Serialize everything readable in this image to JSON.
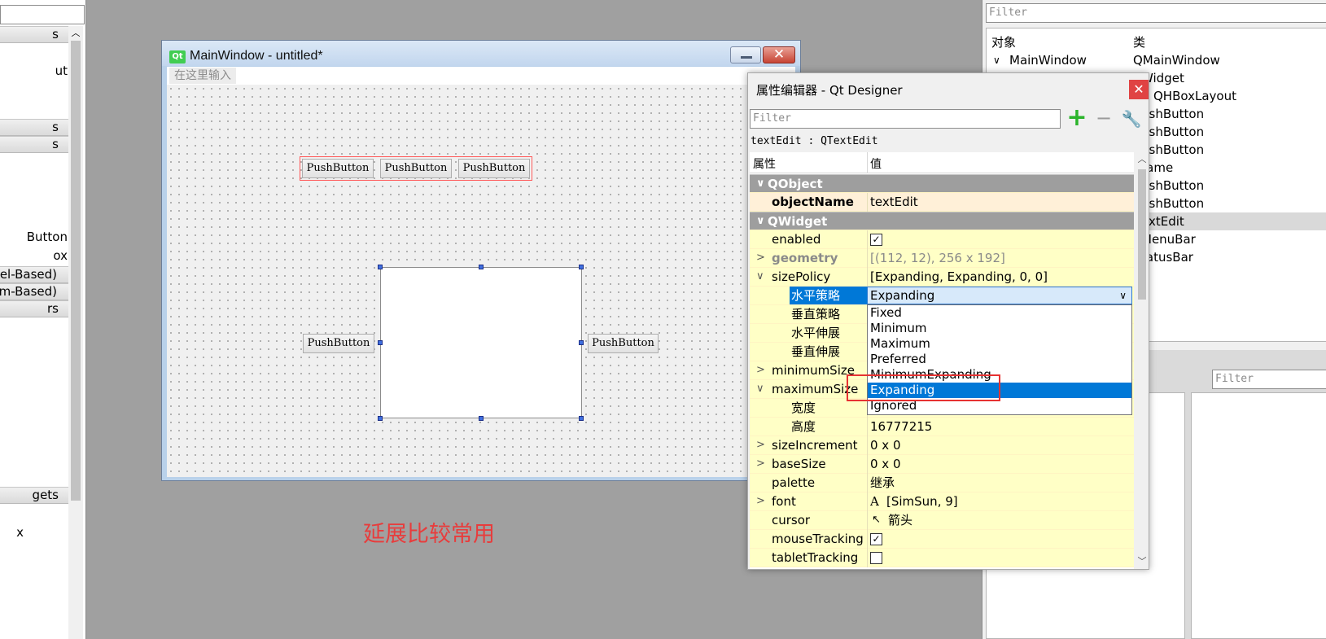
{
  "widget_box": {
    "categories": [
      "s",
      "s",
      "s",
      "del-Based)",
      "em-Based)",
      "rs",
      "gets"
    ],
    "items": [
      "ut",
      "Button",
      "ox",
      "x"
    ]
  },
  "main_window": {
    "title": "MainWindow - untitled*",
    "logo_text": "Qt",
    "menu_placeholder": "在这里输入",
    "close_glyph": "✕",
    "top_buttons": [
      "PushButton",
      "PushButton",
      "PushButton"
    ],
    "left_button": "PushButton",
    "right_button": "PushButton"
  },
  "annotation": "延展比较常用",
  "object_inspector": {
    "filter_placeholder": "Filter",
    "col_object": "对象",
    "col_class": "类",
    "rows": [
      {
        "name": "MainWindow",
        "class": "QMainWindow"
      },
      {
        "name": "",
        "class": "Widget"
      },
      {
        "name": "",
        "class": "QHBoxLayout"
      },
      {
        "name": "",
        "class": "ushButton"
      },
      {
        "name": "",
        "class": "ushButton"
      },
      {
        "name": "",
        "class": "ushButton"
      },
      {
        "name": "",
        "class": "rame"
      },
      {
        "name": "",
        "class": "ushButton"
      },
      {
        "name": "",
        "class": "ushButton"
      },
      {
        "name": "",
        "class": "extEdit"
      },
      {
        "name": "",
        "class": "MenuBar"
      },
      {
        "name": "",
        "class": "tatusBar"
      }
    ],
    "signal_filter_placeholder": "Filter"
  },
  "property_editor": {
    "title": "属性编辑器 - Qt Designer",
    "close_glyph": "✕",
    "filter_placeholder": "Filter",
    "object_info": "textEdit : QTextEdit",
    "col_property": "属性",
    "col_value": "值",
    "rows": [
      {
        "kind": "category",
        "name": "QObject"
      },
      {
        "kind": "prop",
        "name": "objectName",
        "value": "textEdit"
      },
      {
        "kind": "category",
        "name": "QWidget"
      },
      {
        "kind": "prop",
        "name": "enabled",
        "checked": true
      },
      {
        "kind": "prop",
        "name": "geometry",
        "value": "[(112, 12), 256 x 192]"
      },
      {
        "kind": "prop",
        "name": "sizePolicy",
        "value": "[Expanding, Expanding, 0, 0]"
      },
      {
        "kind": "sub",
        "name": "水平策略",
        "value": "Expanding"
      },
      {
        "kind": "sub",
        "name": "垂直策略",
        "value": ""
      },
      {
        "kind": "sub",
        "name": "水平伸展",
        "value": ""
      },
      {
        "kind": "sub",
        "name": "垂直伸展",
        "value": ""
      },
      {
        "kind": "prop",
        "name": "minimumSize",
        "value": ""
      },
      {
        "kind": "prop",
        "name": "maximumSize",
        "value": ""
      },
      {
        "kind": "sub",
        "name": "宽度",
        "value": ""
      },
      {
        "kind": "sub",
        "name": "高度",
        "value": "16777215"
      },
      {
        "kind": "prop",
        "name": "sizeIncrement",
        "value": "0 x 0"
      },
      {
        "kind": "prop",
        "name": "baseSize",
        "value": "0 x 0"
      },
      {
        "kind": "prop",
        "name": "palette",
        "value": "继承"
      },
      {
        "kind": "prop",
        "name": "font",
        "value": "[SimSun, 9]",
        "icon": "A"
      },
      {
        "kind": "prop",
        "name": "cursor",
        "value": "箭头",
        "icon": "cursor-arrow-icon"
      },
      {
        "kind": "prop",
        "name": "mouseTracking",
        "checked": true
      },
      {
        "kind": "prop",
        "name": "tabletTracking",
        "checked": false
      }
    ],
    "combo_value": "Expanding",
    "combo_options": [
      "Fixed",
      "Minimum",
      "Maximum",
      "Preferred",
      "MinimumExpanding",
      "Expanding",
      "Ignored"
    ],
    "combo_selected": "Expanding"
  },
  "colors": {
    "accent_selection": "#0078d7",
    "annotation_red": "#e83c3c",
    "property_yellow": "#ffffc6",
    "category_gray": "#9e9e9e"
  }
}
